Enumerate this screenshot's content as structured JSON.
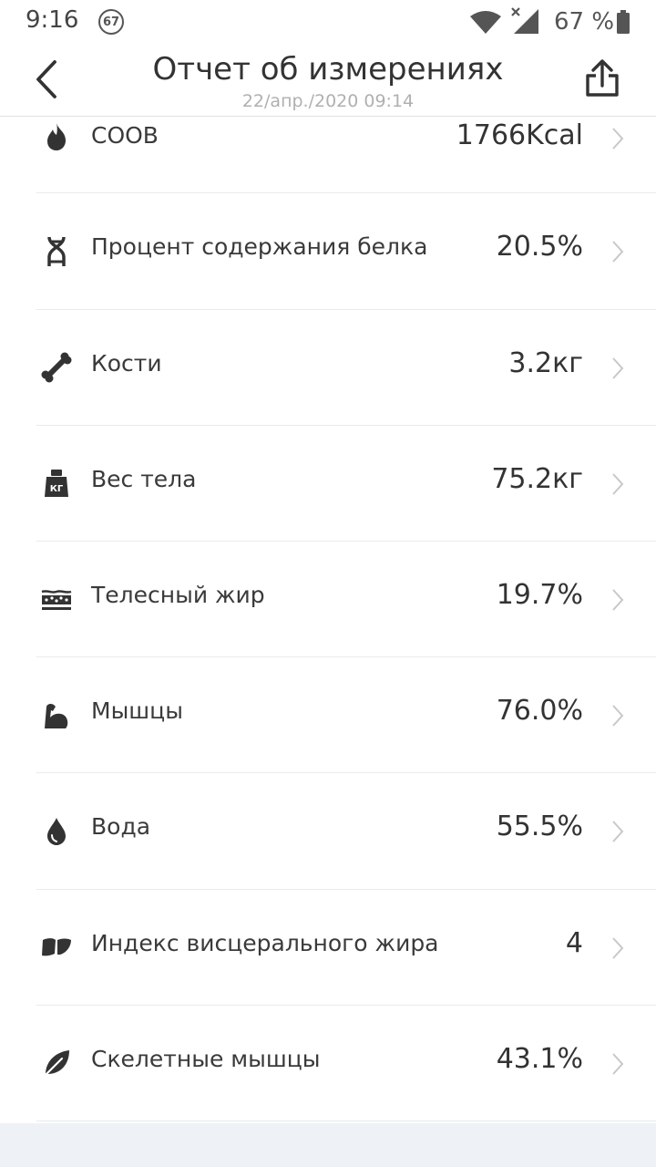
{
  "status_bar": {
    "time": "9:16",
    "notification_count": "67",
    "battery_percent": "67 %"
  },
  "header": {
    "title": "Отчет об измерениях",
    "subtitle": "22/апр./2020 09:14"
  },
  "metrics": [
    {
      "icon": "flame-icon",
      "label": "СООВ",
      "value": "1766Kcal"
    },
    {
      "icon": "dna-icon",
      "label": "Процент содержания белка",
      "value": "20.5%"
    },
    {
      "icon": "bone-icon",
      "label": "Кости",
      "value": "3.2кг"
    },
    {
      "icon": "weight-icon",
      "label": "Вес тела",
      "value": "75.2кг",
      "icon_text": "КГ"
    },
    {
      "icon": "body-fat-icon",
      "label": "Телесный жир",
      "value": "19.7%"
    },
    {
      "icon": "muscle-icon",
      "label": "Мышцы",
      "value": "76.0%"
    },
    {
      "icon": "water-drop-icon",
      "label": "Вода",
      "value": "55.5%"
    },
    {
      "icon": "visceral-fat-icon",
      "label": "Индекс висцерального жира",
      "value": "4"
    },
    {
      "icon": "leaf-icon",
      "label": "Скелетные мышцы",
      "value": "43.1%"
    }
  ],
  "colors": {
    "icon": "#333333",
    "divider": "#e6ecec",
    "subtitle": "#b0b0b0",
    "chevron": "#c8c8c8",
    "bottom_band": "#eef2f6"
  }
}
